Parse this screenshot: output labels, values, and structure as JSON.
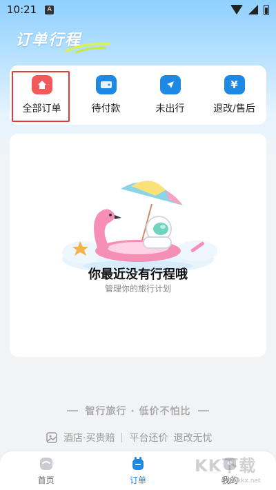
{
  "status_bar": {
    "time": "10:21",
    "notification_letter": "A"
  },
  "header": {
    "title": "订单行程"
  },
  "tabs": [
    {
      "label": "全部订单",
      "icon": "home-icon",
      "color": "#f05a5a"
    },
    {
      "label": "待付款",
      "icon": "wallet-icon",
      "color": "#1e88e5"
    },
    {
      "label": "未出行",
      "icon": "plane-icon",
      "color": "#1e88e5"
    },
    {
      "label": "退改/售后",
      "icon": "yen-icon",
      "color": "#1e88e5"
    }
  ],
  "empty_state": {
    "title": "你最近没有行程哦",
    "subtitle": "管理你的旅行计划",
    "illustration": "beach-astronaut-illustration"
  },
  "slogan": "智行旅行 · 低价不怕比",
  "guarantee": {
    "item1": "酒店·买贵赔",
    "item2": "平台还价",
    "item3": "退改无忧"
  },
  "bottom_nav": [
    {
      "label": "首页",
      "icon": "home-icon"
    },
    {
      "label": "订单",
      "icon": "order-icon",
      "active": true
    },
    {
      "label": "我的",
      "icon": "profile-icon"
    }
  ],
  "watermark": {
    "text": "KK下载",
    "url": "www.kkx.net"
  },
  "colors": {
    "accent": "#1e88e5",
    "highlight_box": "#e53935"
  }
}
